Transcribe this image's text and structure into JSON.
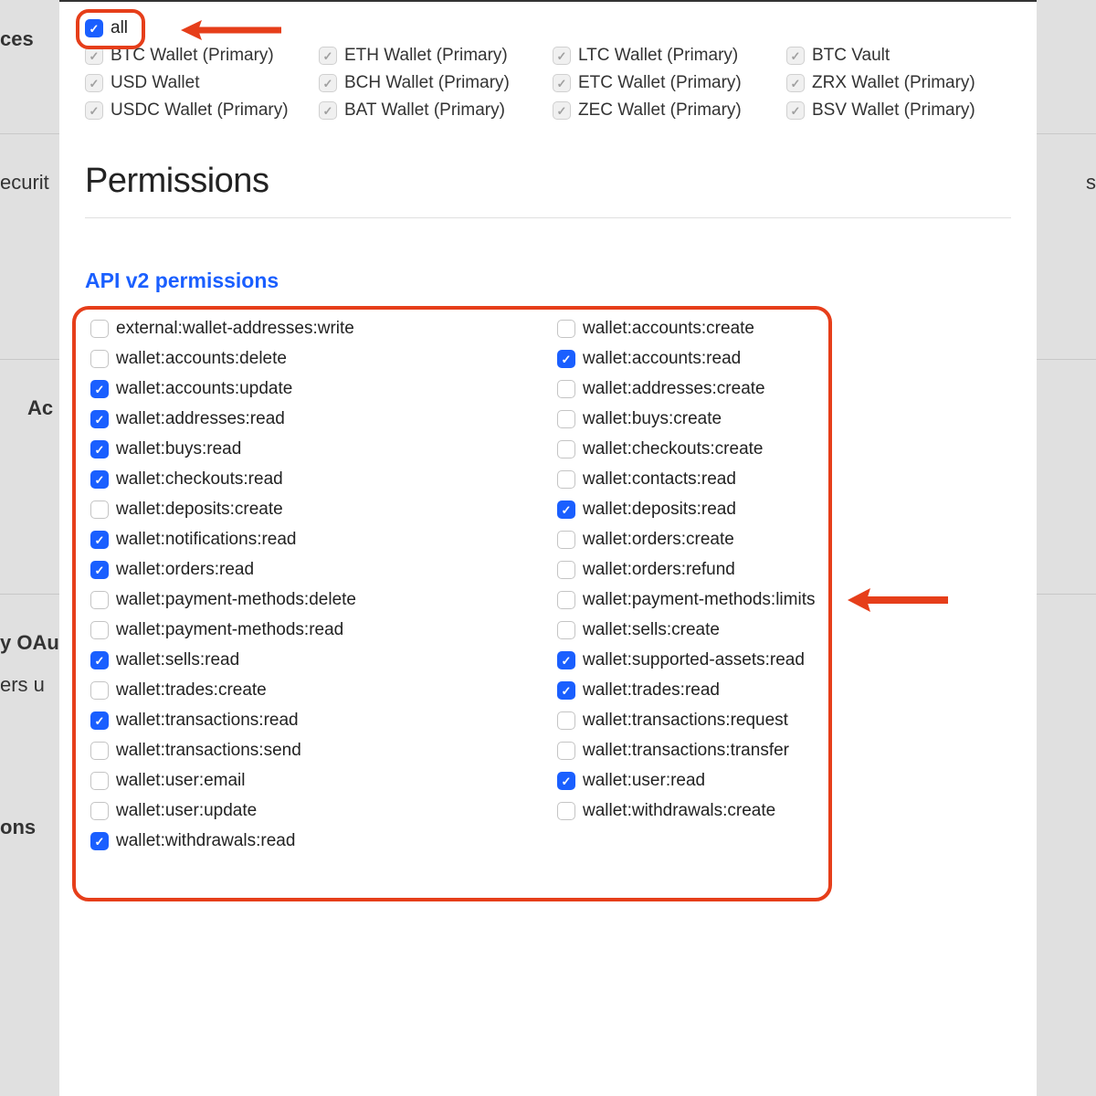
{
  "bg": {
    "left1": "ces",
    "left2": "ecurit",
    "right2": "s",
    "left3": "Ac",
    "left4": "y OAu",
    "left5": "ers u",
    "left6": "ons"
  },
  "wallets": {
    "all_label": "all",
    "items": [
      "BTC Wallet (Primary)",
      "ETH Wallet (Primary)",
      "LTC Wallet (Primary)",
      "BTC Vault",
      "USD Wallet",
      "BCH Wallet (Primary)",
      "ETC Wallet (Primary)",
      "ZRX Wallet (Primary)",
      "USDC Wallet (Primary)",
      "BAT Wallet (Primary)",
      "ZEC Wallet (Primary)",
      "BSV Wallet (Primary)"
    ]
  },
  "heading": "Permissions",
  "subheading": "API v2 permissions",
  "permissions": [
    {
      "label": "external:wallet-addresses:write",
      "checked": false
    },
    {
      "label": "wallet:accounts:create",
      "checked": false
    },
    {
      "label": "wallet:accounts:delete",
      "checked": false
    },
    {
      "label": "wallet:accounts:read",
      "checked": true
    },
    {
      "label": "wallet:accounts:update",
      "checked": true
    },
    {
      "label": "wallet:addresses:create",
      "checked": false
    },
    {
      "label": "wallet:addresses:read",
      "checked": true
    },
    {
      "label": "wallet:buys:create",
      "checked": false
    },
    {
      "label": "wallet:buys:read",
      "checked": true
    },
    {
      "label": "wallet:checkouts:create",
      "checked": false
    },
    {
      "label": "wallet:checkouts:read",
      "checked": true
    },
    {
      "label": "wallet:contacts:read",
      "checked": false
    },
    {
      "label": "wallet:deposits:create",
      "checked": false
    },
    {
      "label": "wallet:deposits:read",
      "checked": true
    },
    {
      "label": "wallet:notifications:read",
      "checked": true
    },
    {
      "label": "wallet:orders:create",
      "checked": false
    },
    {
      "label": "wallet:orders:read",
      "checked": true
    },
    {
      "label": "wallet:orders:refund",
      "checked": false
    },
    {
      "label": "wallet:payment-methods:delete",
      "checked": false
    },
    {
      "label": "wallet:payment-methods:limits",
      "checked": false
    },
    {
      "label": "wallet:payment-methods:read",
      "checked": false
    },
    {
      "label": "wallet:sells:create",
      "checked": false
    },
    {
      "label": "wallet:sells:read",
      "checked": true
    },
    {
      "label": "wallet:supported-assets:read",
      "checked": true
    },
    {
      "label": "wallet:trades:create",
      "checked": false
    },
    {
      "label": "wallet:trades:read",
      "checked": true
    },
    {
      "label": "wallet:transactions:read",
      "checked": true
    },
    {
      "label": "wallet:transactions:request",
      "checked": false
    },
    {
      "label": "wallet:transactions:send",
      "checked": false
    },
    {
      "label": "wallet:transactions:transfer",
      "checked": false
    },
    {
      "label": "wallet:user:email",
      "checked": false
    },
    {
      "label": "wallet:user:read",
      "checked": true
    },
    {
      "label": "wallet:user:update",
      "checked": false
    },
    {
      "label": "wallet:withdrawals:create",
      "checked": false
    },
    {
      "label": "wallet:withdrawals:read",
      "checked": true
    }
  ]
}
